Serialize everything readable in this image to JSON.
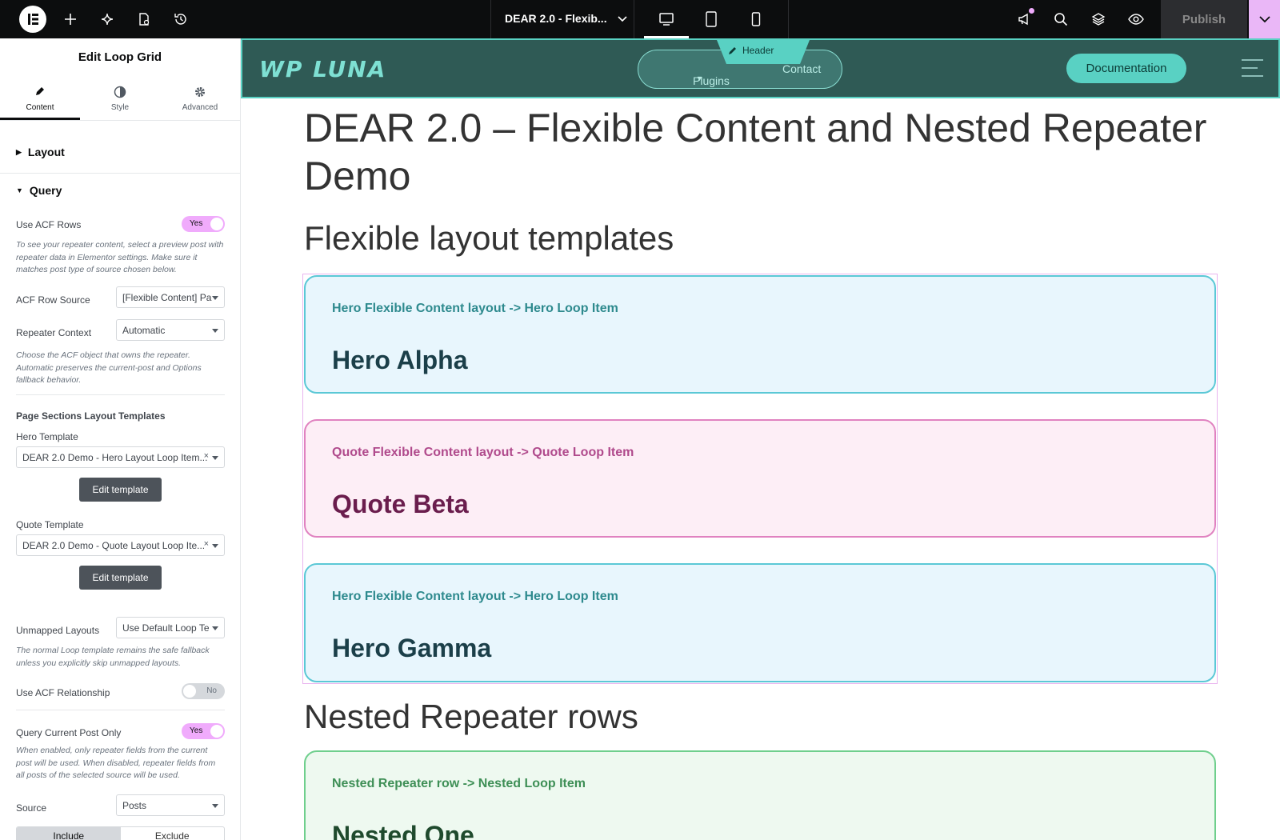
{
  "topbar": {
    "doc_title": "DEAR 2.0 - Flexib...",
    "publish_label": "Publish",
    "icons": [
      "elementor-logo-icon",
      "add-icon",
      "ai-sparkle-icon",
      "page-settings-icon",
      "history-icon",
      "desktop-icon",
      "tablet-icon",
      "mobile-icon",
      "announcements-icon",
      "search-icon",
      "structure-icon",
      "preview-icon",
      "chevron-down-icon"
    ]
  },
  "panel": {
    "title": "Edit Loop Grid",
    "tabs": [
      {
        "label": "Content"
      },
      {
        "label": "Style"
      },
      {
        "label": "Advanced"
      }
    ],
    "sections": {
      "layout": "Layout",
      "query": "Query"
    },
    "use_acf_rows": {
      "label": "Use ACF Rows",
      "value": "Yes"
    },
    "use_acf_rows_note": "To see your repeater content, select a preview post with repeater data in Elementor settings. Make sure it matches post type of source chosen below.",
    "acf_row_source": {
      "label": "ACF Row Source",
      "value": "[Flexible Content] Pa"
    },
    "repeater_context": {
      "label": "Repeater Context",
      "value": "Automatic"
    },
    "repeater_context_note": "Choose the ACF object that owns the repeater. Automatic preserves the current-post and Options fallback behavior.",
    "layout_templates_heading": "Page Sections Layout Templates",
    "hero_template": {
      "label": "Hero Template",
      "value": "DEAR 2.0 Demo - Hero Layout Loop Item..."
    },
    "quote_template": {
      "label": "Quote Template",
      "value": "DEAR 2.0 Demo - Quote Layout Loop Ite..."
    },
    "edit_template_label": "Edit template",
    "unmapped_layouts": {
      "label": "Unmapped Layouts",
      "value": "Use Default Loop Te"
    },
    "unmapped_note": "The normal Loop template remains the safe fallback unless you explicitly skip unmapped layouts.",
    "use_acf_relationship": {
      "label": "Use ACF Relationship",
      "value": "No"
    },
    "query_current_post": {
      "label": "Query Current Post Only",
      "value": "Yes"
    },
    "query_current_note": "When enabled, only repeater fields from the current post will be used. When disabled, repeater fields from all posts of the selected source will be used.",
    "source": {
      "label": "Source",
      "value": "Posts"
    },
    "include_label": "Include",
    "exclude_label": "Exclude"
  },
  "site": {
    "logo_text": "WP LUNA",
    "nav": {
      "plugins": "Plugins",
      "contact": "Contact"
    },
    "header_tag": "Header",
    "doc_button": "Documentation"
  },
  "page": {
    "title": "DEAR 2.0 – Flexible Content and Nested Repeater Demo",
    "section1": "Flexible layout templates",
    "section2": "Nested Repeater rows",
    "cards": [
      {
        "subtitle": "Hero Flexible Content layout -> Hero Loop Item",
        "title": "Hero Alpha"
      },
      {
        "subtitle": "Quote Flexible Content layout -> Quote Loop Item",
        "title": "Quote Beta"
      },
      {
        "subtitle": "Hero Flexible Content layout -> Hero Loop Item",
        "title": "Hero Gamma"
      },
      {
        "subtitle": "Nested Repeater row -> Nested Loop Item",
        "title": "Nested One"
      }
    ]
  },
  "colors": {
    "accent": "#f0abfc",
    "header_bg": "#2f5a55",
    "teal": "#59d1c3"
  }
}
